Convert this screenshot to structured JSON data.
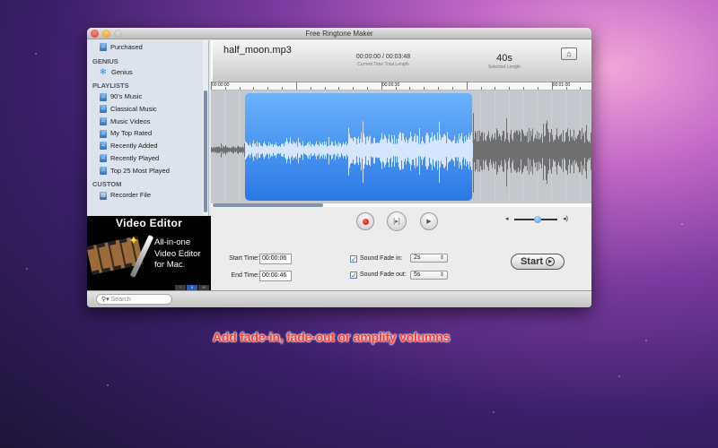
{
  "window": {
    "title": "Free Ringtone Maker"
  },
  "sidebar": {
    "top_item": {
      "label": "Purchased",
      "icon": "store-icon"
    },
    "sections": [
      {
        "heading": "GENIUS",
        "items": [
          {
            "label": "Genius",
            "icon": "genius-icon"
          }
        ]
      },
      {
        "heading": "PLAYLISTS",
        "items": [
          {
            "label": "90's Music",
            "icon": "playlist-icon"
          },
          {
            "label": "Classical Music",
            "icon": "playlist-icon"
          },
          {
            "label": "Music Videos",
            "icon": "playlist-icon"
          },
          {
            "label": "My Top Rated",
            "icon": "playlist-icon"
          },
          {
            "label": "Recently Added",
            "icon": "playlist-icon"
          },
          {
            "label": "Recently Played",
            "icon": "playlist-icon"
          },
          {
            "label": "Top 25 Most Played",
            "icon": "playlist-icon"
          }
        ]
      },
      {
        "heading": "CUSTOM",
        "items": [
          {
            "label": "Recorder File",
            "icon": "recorder-icon"
          }
        ]
      }
    ]
  },
  "ad": {
    "title": "Video Editor",
    "lines": [
      "All-in-one",
      "Video Editor",
      "for Mac."
    ],
    "pages": [
      "I",
      "II",
      "III"
    ],
    "active_page": 1
  },
  "search": {
    "placeholder": "Search"
  },
  "header": {
    "file_name": "half_moon.mp3",
    "time_display": "00:00:00 / 00:03:48",
    "time_sub": "Current Time   Total Length",
    "selected_length": "40s",
    "selected_sub": "Selected Length",
    "home_icon": "home-icon"
  },
  "ruler": {
    "labels": [
      {
        "text": "00:00:00",
        "t": 0
      },
      {
        "text": "00:00:30",
        "t": 30
      },
      {
        "text": "00:01:00",
        "t": 60
      }
    ],
    "visible_seconds": 67
  },
  "waveform": {
    "selection_start_s": 6,
    "selection_end_s": 46,
    "selection_color": "#3d8ff0",
    "wave_color": "#6f6f6f",
    "selected_wave_color": "#d6e6ff",
    "scroll_position": 0.0,
    "scroll_visible_fraction": 0.29
  },
  "controls": {
    "record_icon": "record-icon",
    "loop_play_icon": "play-selection-icon",
    "play_icon": "play-icon",
    "volume_level": 0.55,
    "start_time_label": "Start Time:",
    "start_time": "00:00:06",
    "end_time_label": "End Time:",
    "end_time": "00:00:46",
    "fade_in": {
      "label": "Sound Fade in:",
      "checked": true,
      "value": "2s"
    },
    "fade_out": {
      "label": "Sound Fade out:",
      "checked": true,
      "value": "5s"
    },
    "start_label": "Start"
  },
  "caption": "Add fade-in, fade-out or amplify volumns"
}
